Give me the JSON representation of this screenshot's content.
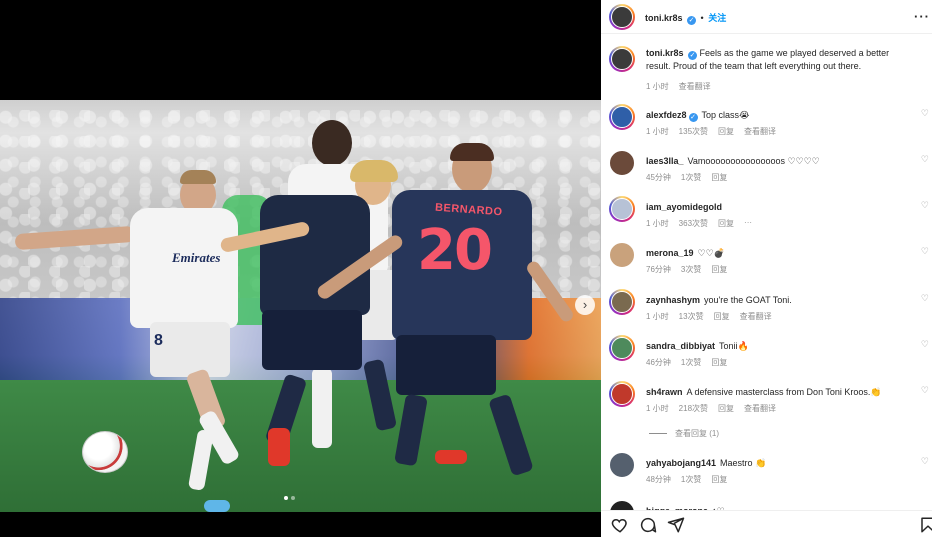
{
  "post": {
    "username": "toni.kr8s",
    "verified_mark": "✓",
    "follow_label": "关注",
    "more_label": "···",
    "caption_user": "toni.kr8s",
    "caption_text": "Feels as the game we played deserved a better result. Proud of the team that left everything out there.",
    "caption_time": "1 小时",
    "caption_translate": "查看翻译"
  },
  "media": {
    "jersey_number": "20",
    "jersey_name": "BERNARDO",
    "sponsor": "Emirates",
    "white_number": "8",
    "next_label": "›",
    "dots_count": 2,
    "active_dot": 0
  },
  "comments": [
    {
      "user": "alexfdez8",
      "verified": true,
      "text": "Top class😭",
      "time": "1 小时",
      "likes": "135次赞",
      "reply": "回复",
      "translate": "查看翻译",
      "avatar_color": "#2f5fa8"
    },
    {
      "user": "laes3lla_",
      "verified": false,
      "text": "Vamooooooooooooooos ♡♡♡♡",
      "time": "45分钟",
      "likes": "1次赞",
      "reply": "回复",
      "translate": "",
      "avatar_color": "#6b4a3a"
    },
    {
      "user": "iam_ayomidegold",
      "verified": false,
      "text": "",
      "time": "1 小时",
      "likes": "363次赞",
      "reply": "回复",
      "translate": "···",
      "avatar_color": "#b7c2d6"
    },
    {
      "user": "merona_19",
      "verified": false,
      "text": "♡♡💣",
      "time": "76分钟",
      "likes": "3次赞",
      "reply": "回复",
      "translate": "",
      "avatar_color": "#c9a27c"
    },
    {
      "user": "zaynhashym",
      "verified": false,
      "text": "you're the GOAT Toni.",
      "time": "1 小时",
      "likes": "13次赞",
      "reply": "回复",
      "translate": "查看翻译",
      "avatar_color": "#7a6a4f"
    },
    {
      "user": "sandra_dibbiyat",
      "verified": false,
      "text": "Tonii🔥",
      "time": "46分钟",
      "likes": "1次赞",
      "reply": "回复",
      "translate": "",
      "avatar_color": "#4e8a5c"
    },
    {
      "user": "sh4rawn",
      "verified": false,
      "text": "A defensive masterclass from Don Toni Kroos.👏",
      "time": "1 小时",
      "likes": "218次赞",
      "reply": "回复",
      "translate": "查看翻译",
      "avatar_color": "#c0392b"
    },
    {
      "user": "yahyabojang141",
      "verified": false,
      "text": "Maestro 👏",
      "time": "48分钟",
      "likes": "1次赞",
      "reply": "回复",
      "translate": "",
      "avatar_color": "#55606e"
    },
    {
      "user": "bigge_morona",
      "verified": false,
      "text": "♦♡",
      "time": "",
      "likes": "",
      "reply": "",
      "translate": "",
      "avatar_color": "#222222"
    }
  ],
  "view_replies_label": "查看回复 (1)",
  "actions": {
    "like_icon": "heart-icon",
    "comment_icon": "comment-icon",
    "share_icon": "share-icon",
    "save_icon": "bookmark-icon"
  }
}
